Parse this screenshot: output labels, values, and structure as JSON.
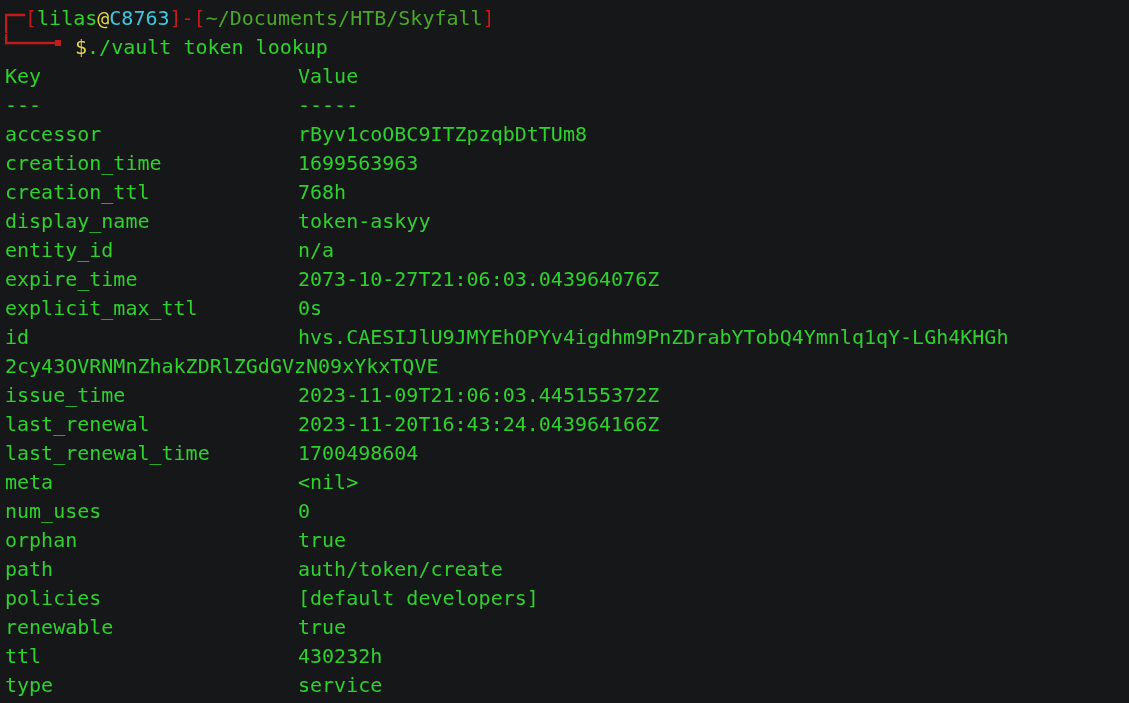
{
  "prompt": {
    "segments": [
      {
        "kind": "bracket",
        "text": "["
      },
      {
        "kind": "user",
        "text": "lilas"
      },
      {
        "kind": "at",
        "text": "@"
      },
      {
        "kind": "host",
        "text": "C8763"
      },
      {
        "kind": "bracket",
        "text": "]-["
      },
      {
        "kind": "path",
        "text": "~/Documents/HTB/Skyfall"
      },
      {
        "kind": "bracket",
        "text": "]"
      }
    ],
    "symbol": "$",
    "command": "./vault token lookup"
  },
  "table": {
    "columns": [
      "Key",
      "Value"
    ],
    "separators": [
      "---",
      "-----"
    ],
    "rows": [
      {
        "key": "accessor",
        "value": "rByv1coOBC9ITZpzqbDtTUm8"
      },
      {
        "key": "creation_time",
        "value": "1699563963"
      },
      {
        "key": "creation_ttl",
        "value": "768h"
      },
      {
        "key": "display_name",
        "value": "token-askyy"
      },
      {
        "key": "entity_id",
        "value": "n/a"
      },
      {
        "key": "expire_time",
        "value": "2073-10-27T21:06:03.043964076Z"
      },
      {
        "key": "explicit_max_ttl",
        "value": "0s"
      },
      {
        "key": "id",
        "value": "hvs.CAESIJlU9JMYEhOPYv4igdhm9PnZDrabYTobQ4Ymnlq1qY-LGh4KHGh",
        "continuation": "2cy43OVRNMnZhakZDRlZGdGVzN09xYkxTQVE"
      },
      {
        "key": "issue_time",
        "value": "2023-11-09T21:06:03.445155372Z"
      },
      {
        "key": "last_renewal",
        "value": "2023-11-20T16:43:24.043964166Z"
      },
      {
        "key": "last_renewal_time",
        "value": "1700498604"
      },
      {
        "key": "meta",
        "value": "<nil>"
      },
      {
        "key": "num_uses",
        "value": "0"
      },
      {
        "key": "orphan",
        "value": "true"
      },
      {
        "key": "path",
        "value": "auth/token/create"
      },
      {
        "key": "policies",
        "value": "[default developers]"
      },
      {
        "key": "renewable",
        "value": "true"
      },
      {
        "key": "ttl",
        "value": "430232h"
      },
      {
        "key": "type",
        "value": "service"
      }
    ]
  }
}
